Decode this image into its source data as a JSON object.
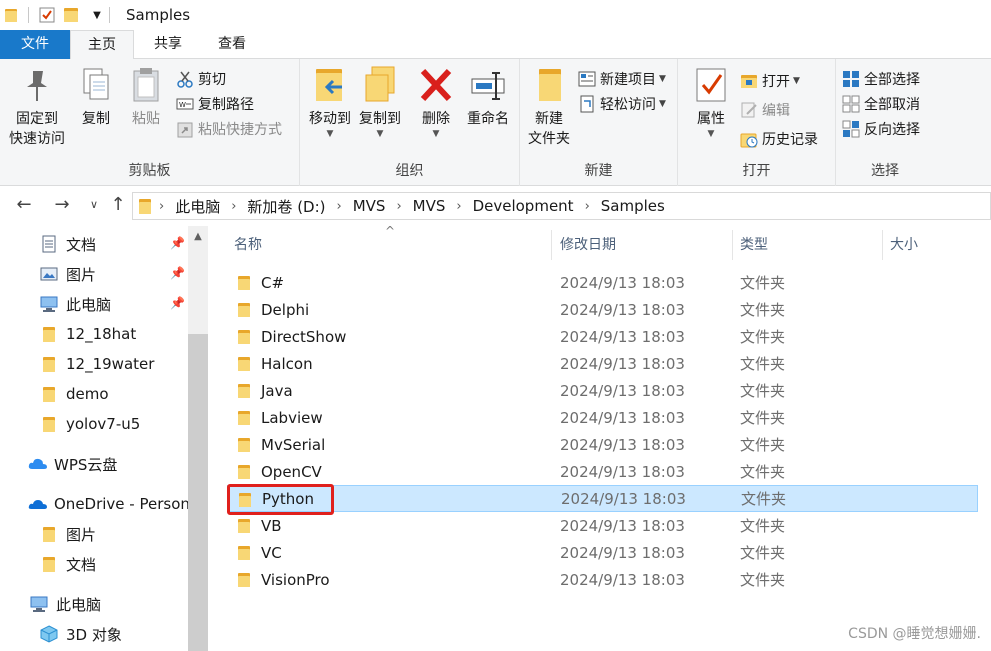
{
  "window": {
    "title": "Samples"
  },
  "ribbon_tabs": {
    "file": "文件",
    "home": "主页",
    "share": "共享",
    "view": "查看"
  },
  "clipboard": {
    "pin_quick_access": [
      "固定到",
      "快速访问"
    ],
    "copy": "复制",
    "paste": "粘贴",
    "cut": "剪切",
    "copy_path": "复制路径",
    "paste_shortcut": "粘贴快捷方式",
    "group_label": "剪贴板"
  },
  "organize": {
    "move_to": "移动到",
    "copy_to": "复制到",
    "delete": "删除",
    "rename": "重命名",
    "group_label": "组织"
  },
  "new": {
    "new_folder": [
      "新建",
      "文件夹"
    ],
    "new_item": "新建项目",
    "easy_access": "轻松访问",
    "group_label": "新建"
  },
  "open": {
    "properties": "属性",
    "open": "打开",
    "edit": "编辑",
    "history": "历史记录",
    "group_label": "打开"
  },
  "select": {
    "select_all": "全部选择",
    "select_none": "全部取消",
    "invert": "反向选择",
    "group_label": "选择"
  },
  "address_bar": {
    "breadcrumbs": [
      "此电脑",
      "新加卷 (D:)",
      "MVS",
      "MVS",
      "Development",
      "Samples"
    ]
  },
  "nav_pane": {
    "items": [
      {
        "label": "文档",
        "icon": "documents-icon",
        "pinned": true
      },
      {
        "label": "图片",
        "icon": "pictures-icon",
        "pinned": true
      },
      {
        "label": "此电脑",
        "icon": "this-pc-icon",
        "pinned": true
      },
      {
        "label": "12_18hat",
        "icon": "folder-icon",
        "pinned": false
      },
      {
        "label": "12_19water",
        "icon": "folder-icon",
        "pinned": false
      },
      {
        "label": "demo",
        "icon": "folder-icon",
        "pinned": false
      },
      {
        "label": "yolov7-u5",
        "icon": "folder-icon",
        "pinned": false
      },
      {
        "label": "WPS云盘",
        "icon": "cloud-icon",
        "pinned": false
      },
      {
        "label": "OneDrive - Person",
        "icon": "onedrive-icon",
        "pinned": false
      },
      {
        "label": "图片",
        "icon": "folder-icon",
        "pinned": false
      },
      {
        "label": "文档",
        "icon": "folder-icon",
        "pinned": false
      },
      {
        "label": "此电脑",
        "icon": "this-pc-icon",
        "pinned": false
      },
      {
        "label": "3D 对象",
        "icon": "3d-objects-icon",
        "pinned": false
      }
    ]
  },
  "file_list": {
    "columns": {
      "name": "名称",
      "modified": "修改日期",
      "type": "类型",
      "size": "大小"
    },
    "rows": [
      {
        "name": "C#",
        "modified": "2024/9/13 18:03",
        "type": "文件夹"
      },
      {
        "name": "Delphi",
        "modified": "2024/9/13 18:03",
        "type": "文件夹"
      },
      {
        "name": "DirectShow",
        "modified": "2024/9/13 18:03",
        "type": "文件夹"
      },
      {
        "name": "Halcon",
        "modified": "2024/9/13 18:03",
        "type": "文件夹"
      },
      {
        "name": "Java",
        "modified": "2024/9/13 18:03",
        "type": "文件夹"
      },
      {
        "name": "Labview",
        "modified": "2024/9/13 18:03",
        "type": "文件夹"
      },
      {
        "name": "MvSerial",
        "modified": "2024/9/13 18:03",
        "type": "文件夹"
      },
      {
        "name": "OpenCV",
        "modified": "2024/9/13 18:03",
        "type": "文件夹"
      },
      {
        "name": "Python",
        "modified": "2024/9/13 18:03",
        "type": "文件夹",
        "selected": true
      },
      {
        "name": "VB",
        "modified": "2024/9/13 18:03",
        "type": "文件夹"
      },
      {
        "name": "VC",
        "modified": "2024/9/13 18:03",
        "type": "文件夹"
      },
      {
        "name": "VisionPro",
        "modified": "2024/9/13 18:03",
        "type": "文件夹"
      }
    ]
  },
  "watermark": "CSDN @睡觉想姗姗.",
  "colors": {
    "accent": "#1979ca",
    "selection": "#cce8ff",
    "highlight": "#e0201c",
    "folder": "#f8d775"
  }
}
